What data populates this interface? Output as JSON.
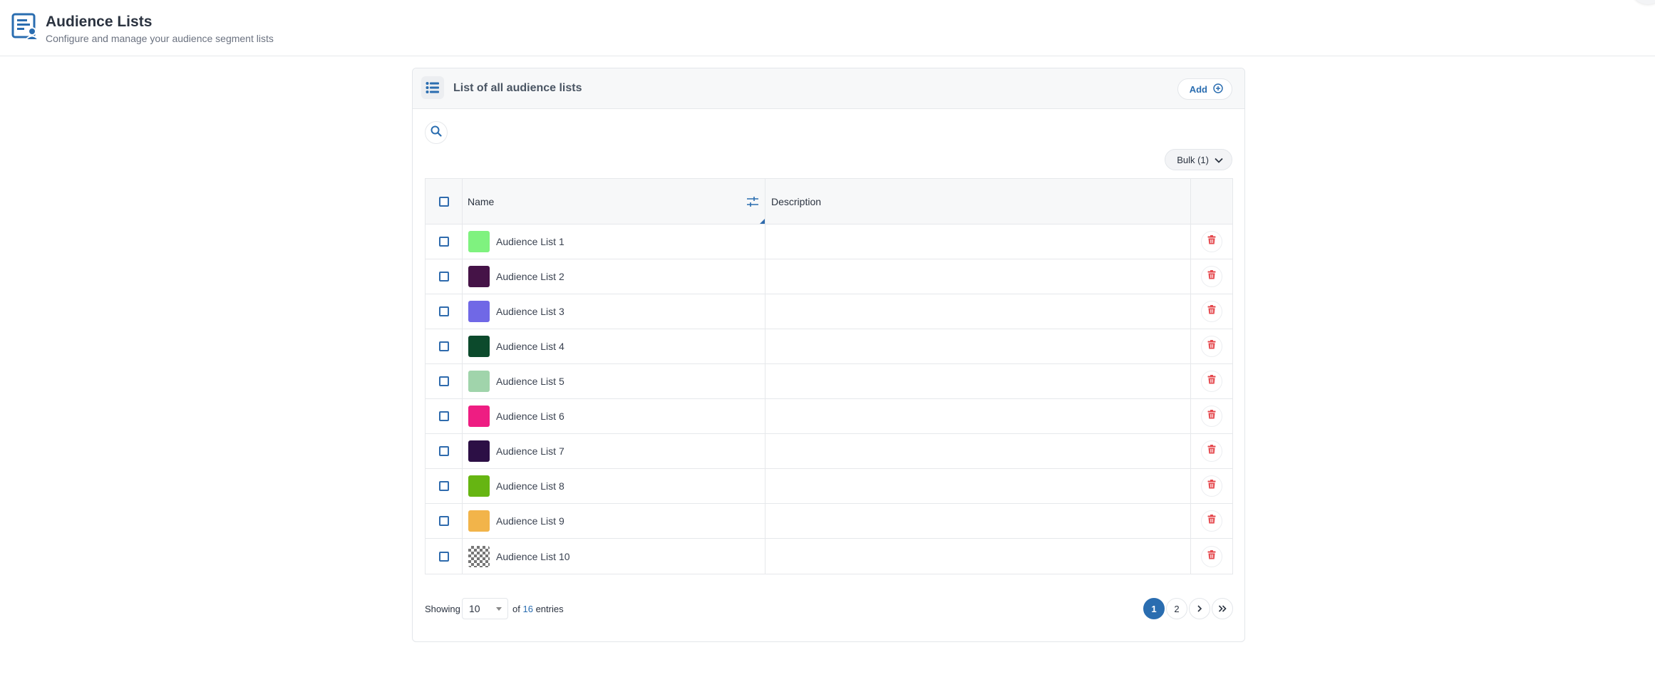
{
  "header": {
    "title": "Audience Lists",
    "subtitle": "Configure and manage your audience segment lists",
    "icon": "audience-list-icon"
  },
  "card": {
    "title": "List of all audience lists",
    "add_label": "Add",
    "bulk_label": "Bulk (1)"
  },
  "table": {
    "columns": [
      "Name",
      "Description"
    ],
    "rows": [
      {
        "name": "Audience List 1",
        "description": "",
        "color": "#7ff27f"
      },
      {
        "name": "Audience List 2",
        "description": "",
        "color": "#451347"
      },
      {
        "name": "Audience List 3",
        "description": "",
        "color": "#7068e6"
      },
      {
        "name": "Audience List 4",
        "description": "",
        "color": "#0c4a2c"
      },
      {
        "name": "Audience List 5",
        "description": "",
        "color": "#a0d4ab"
      },
      {
        "name": "Audience List 6",
        "description": "",
        "color": "#ee1d82"
      },
      {
        "name": "Audience List 7",
        "description": "",
        "color": "#2c0f45"
      },
      {
        "name": "Audience List 8",
        "description": "",
        "color": "#66b512"
      },
      {
        "name": "Audience List 9",
        "description": "",
        "color": "#f2b44a"
      },
      {
        "name": "Audience List 10",
        "description": "",
        "color": "checkered"
      }
    ]
  },
  "footer": {
    "showing_label": "Showing",
    "per_page": "10",
    "of_label": "of",
    "total": "16",
    "entries_label": "entries",
    "pages": [
      "1",
      "2"
    ],
    "current_page": "1"
  },
  "colors": {
    "accent": "#2a6db0",
    "danger": "#e5484d"
  }
}
